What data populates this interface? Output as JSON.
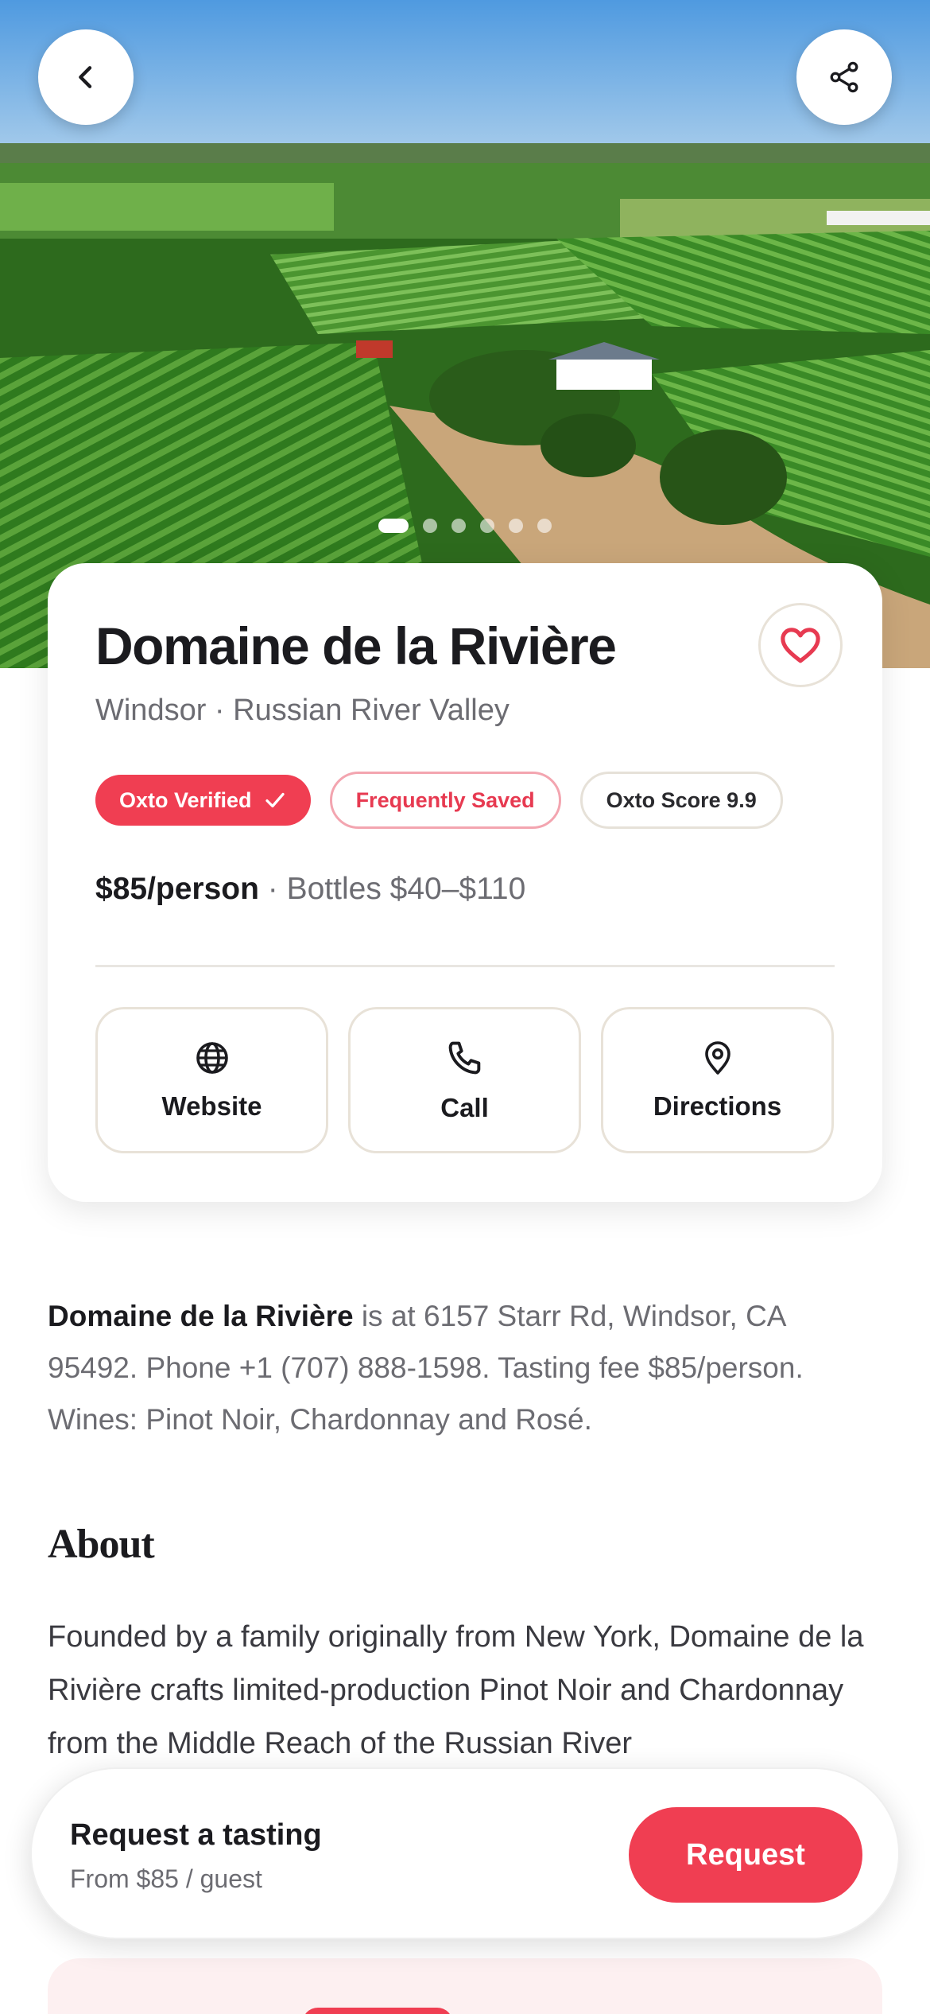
{
  "hero": {
    "photo_icon": "vineyard-aerial-photo",
    "carousel_count": 6,
    "carousel_active_index": 0
  },
  "winery": {
    "name": "Domaine de la Rivière",
    "location": "Windsor · Russian River Valley",
    "badges": {
      "verified": "Oxto Verified",
      "saved": "Frequently Saved",
      "score": "Oxto Score 9.9"
    },
    "price_main": "$85/person",
    "price_rest": " · Bottles $40–$110"
  },
  "actions": {
    "website": "Website",
    "call": "Call",
    "directions": "Directions"
  },
  "summary": {
    "name": "Domaine de la Rivière",
    "text": " is at 6157 Starr Rd, Windsor, CA 95492. Phone +1 (707) 888-1598. Tasting fee $85/person. Wines: Pinot Noir, Chardonnay and Rosé."
  },
  "about": {
    "heading": "About",
    "text": "Founded by a family originally from New York, Domaine de la Rivière crafts limited-production Pinot Noir and Chardonnay from the Middle Reach of the Russian River"
  },
  "booking": {
    "title": "Request a tasting",
    "subtitle": "From $85 / guest",
    "button": "Request"
  },
  "colors": {
    "accent": "#f03e52",
    "text": "#1b1b1f",
    "muted": "#6c6c72",
    "border": "#e8e2d8"
  }
}
